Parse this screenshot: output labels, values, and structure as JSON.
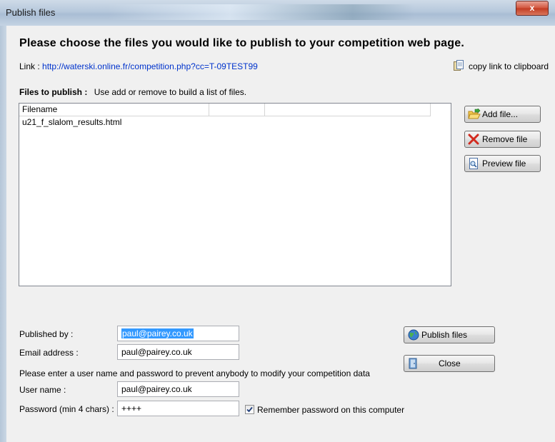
{
  "window": {
    "title": "Publish files",
    "close_glyph": "x"
  },
  "heading": "Please choose the files you would like to publish to your competition web page.",
  "link": {
    "label": "Link :",
    "url": "http://waterski.online.fr/competition.php?cc=T-09TEST99",
    "copy_label": "copy link to clipboard"
  },
  "files": {
    "section_label": "Files to publish :",
    "hint": "Use add or remove to build a list of files.",
    "columns": [
      "Filename",
      "",
      ""
    ],
    "rows": [
      "u21_f_slalom_results.html"
    ]
  },
  "buttons": {
    "add": "Add file...",
    "remove": "Remove file",
    "preview": "Preview file",
    "publish": "Publish files",
    "close": "Close"
  },
  "form": {
    "published_by_label": "Published by :",
    "published_by_value": "paul@pairey.co.uk",
    "email_label": "Email address :",
    "email_value": "paul@pairey.co.uk",
    "note": "Please enter a user name and password to prevent anybody to modify your competition data",
    "username_label": "User name :",
    "username_value": "paul@pairey.co.uk",
    "password_label": "Password (min 4 chars) :",
    "password_value": "++++",
    "remember_label": "Remember password on this computer",
    "remember_checked": true
  },
  "colors": {
    "link": "#0033cc",
    "selection": "#3399ff",
    "close_button": "#c23b22"
  }
}
